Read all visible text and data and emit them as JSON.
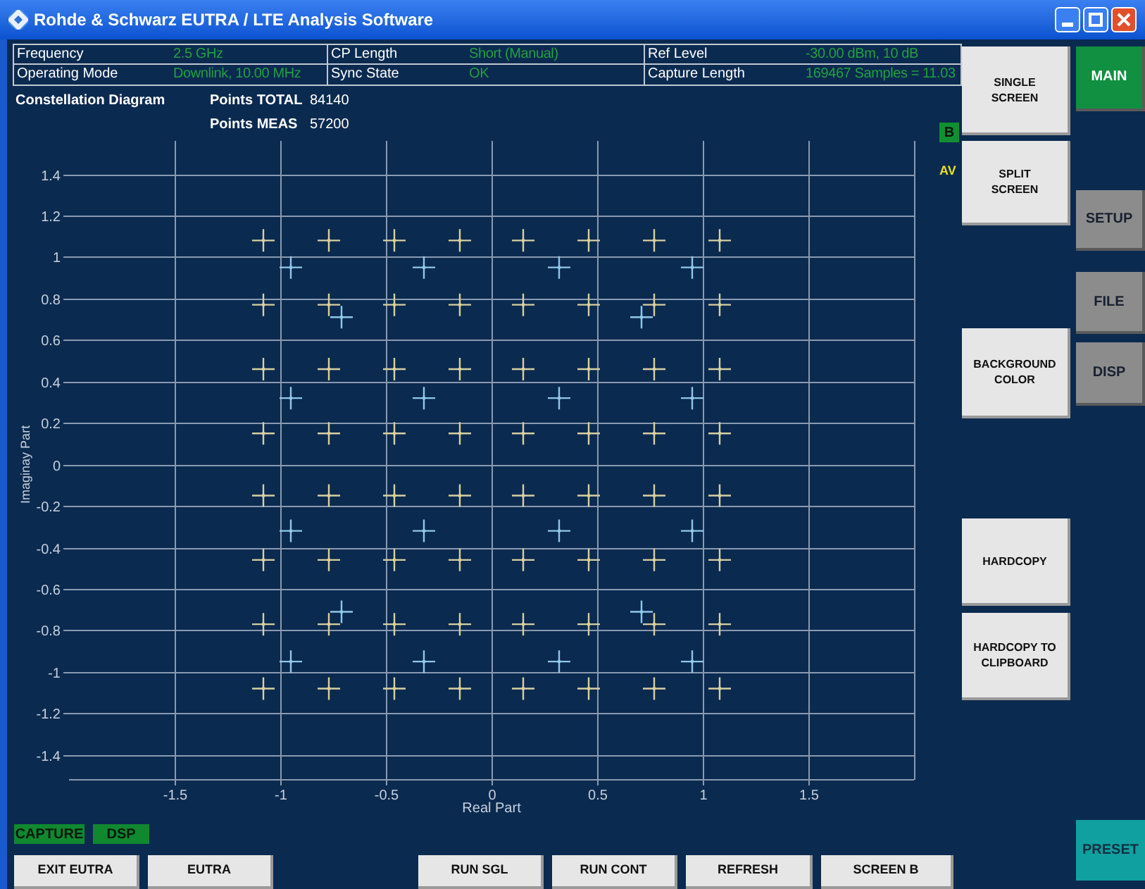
{
  "window": {
    "title": "Rohde & Schwarz EUTRA / LTE Analysis Software"
  },
  "info_table": [
    [
      {
        "label": "Frequency",
        "value": "2.5 GHz"
      },
      {
        "label": "CP Length",
        "value": "Short (Manual)"
      },
      {
        "label": "Ref Level",
        "value": "-30.00 dBm, 10 dB"
      }
    ],
    [
      {
        "label": "Operating Mode",
        "value": "Downlink, 10.00 MHz"
      },
      {
        "label": "Sync State",
        "value": "OK"
      },
      {
        "label": "Capture Length",
        "value": "169467 Samples = 11.03"
      }
    ]
  ],
  "diagram": {
    "title": "Constellation Diagram",
    "stats": [
      {
        "label": "Points TOTAL",
        "value": "84140"
      },
      {
        "label": "Points MEAS",
        "value": "57200"
      }
    ],
    "badge": "B",
    "trace_mode": "AV",
    "chart_data": {
      "type": "scatter",
      "xlabel": "Real Part",
      "ylabel": "Imaginay Part",
      "xlim": [
        -2,
        2
      ],
      "ylim": [
        -1.52,
        1.56
      ],
      "grid": true,
      "xticks": [
        -1.5,
        -1,
        -0.5,
        0,
        0.5,
        1,
        1.5
      ],
      "yticks": [
        1.4,
        1.2,
        1,
        0.8,
        0.6,
        0.4,
        0.2,
        0,
        -0.2,
        -0.4,
        -0.6,
        -0.8,
        -1,
        -1.2,
        -1.4
      ],
      "series": [
        {
          "color": "#d8d0a0",
          "x": [
            -1.08,
            -0.77,
            -0.46,
            -0.15,
            0.15,
            0.46,
            0.77,
            1.08,
            -1.08,
            -0.77,
            -0.46,
            -0.15,
            0.15,
            0.46,
            0.77,
            1.08,
            -1.08,
            -0.77,
            -0.46,
            -0.15,
            0.15,
            0.46,
            0.77,
            1.08,
            -1.08,
            -0.77,
            -0.46,
            -0.15,
            0.15,
            0.46,
            0.77,
            1.08,
            -1.08,
            -0.77,
            -0.46,
            -0.15,
            0.15,
            0.46,
            0.77,
            1.08,
            -1.08,
            -0.77,
            -0.46,
            -0.15,
            0.15,
            0.46,
            0.77,
            1.08,
            -1.08,
            -0.77,
            -0.46,
            -0.15,
            0.15,
            0.46,
            0.77,
            1.08,
            -1.08,
            -0.77,
            -0.46,
            -0.15,
            0.15,
            0.46,
            0.77,
            1.08
          ],
          "values": [
            1.08,
            1.08,
            1.08,
            1.08,
            1.08,
            1.08,
            1.08,
            1.08,
            0.77,
            0.77,
            0.77,
            0.77,
            0.77,
            0.77,
            0.77,
            0.77,
            0.46,
            0.46,
            0.46,
            0.46,
            0.46,
            0.46,
            0.46,
            0.46,
            0.15,
            0.15,
            0.15,
            0.15,
            0.15,
            0.15,
            0.15,
            0.15,
            -0.15,
            -0.15,
            -0.15,
            -0.15,
            -0.15,
            -0.15,
            -0.15,
            -0.15,
            -0.46,
            -0.46,
            -0.46,
            -0.46,
            -0.46,
            -0.46,
            -0.46,
            -0.46,
            -0.77,
            -0.77,
            -0.77,
            -0.77,
            -0.77,
            -0.77,
            -0.77,
            -0.77,
            -1.08,
            -1.08,
            -1.08,
            -1.08,
            -1.08,
            -1.08,
            -1.08,
            -1.08
          ]
        },
        {
          "color": "#90c8e8",
          "x": [
            -0.95,
            -0.32,
            0.32,
            0.95,
            -0.95,
            -0.32,
            0.32,
            0.95,
            -0.95,
            -0.32,
            0.32,
            0.95,
            -0.95,
            -0.32,
            0.32,
            0.95,
            -0.71,
            0.71,
            -0.71,
            0.71
          ],
          "values": [
            0.95,
            0.95,
            0.95,
            0.95,
            0.32,
            0.32,
            0.32,
            0.32,
            -0.32,
            -0.32,
            -0.32,
            -0.32,
            -0.95,
            -0.95,
            -0.95,
            -0.95,
            0.71,
            0.71,
            -0.71,
            -0.71
          ]
        }
      ]
    }
  },
  "status_indicators": [
    "CAPTURE",
    "DSP"
  ],
  "bottom_buttons": [
    "EXIT EUTRA",
    "EUTRA",
    "RUN SGL",
    "RUN CONT",
    "REFRESH",
    "SCREEN B"
  ],
  "side_buttons": [
    "SINGLE SCREEN",
    "SPLIT SCREEN",
    "BACKGROUND COLOR",
    "HARDCOPY",
    "HARDCOPY TO CLIPBOARD"
  ],
  "menu_buttons": [
    {
      "label": "MAIN",
      "selected": true
    },
    {
      "label": "SETUP",
      "selected": false
    },
    {
      "label": "FILE",
      "selected": false
    },
    {
      "label": "DISP",
      "selected": false
    }
  ],
  "preset_button": "PRESET"
}
